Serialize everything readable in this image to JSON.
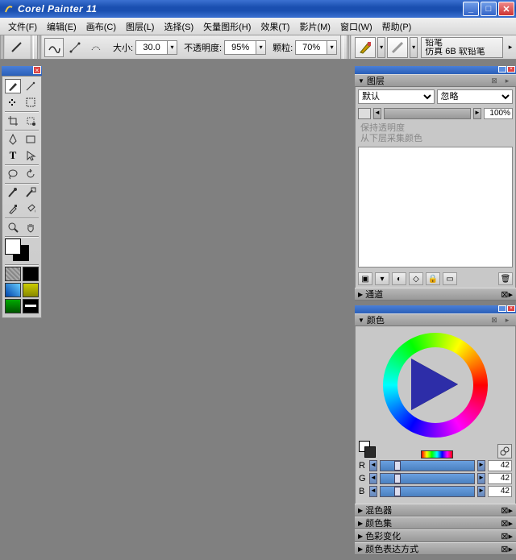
{
  "app_title": "Corel Painter 11",
  "menu": [
    "文件(F)",
    "编辑(E)",
    "画布(C)",
    "图层(L)",
    "选择(S)",
    "矢量图形(H)",
    "效果(T)",
    "影片(M)",
    "窗口(W)",
    "帮助(P)"
  ],
  "options": {
    "size_label": "大小:",
    "size_value": "30.0",
    "opacity_label": "不透明度:",
    "opacity_value": "95%",
    "grain_label": "颗粒:",
    "grain_value": "70%"
  },
  "brush": {
    "category": "铅笔",
    "variant": "仿真 6B 软铅笔"
  },
  "panels": {
    "layers": {
      "title": "图层",
      "blend_mode": "默认",
      "composite": "忽略",
      "opacity": "100%",
      "lock_trans": "保持透明度",
      "pick_color": "从下层采集颜色",
      "channels_title": "通道"
    },
    "color": {
      "title": "颜色",
      "r_label": "R",
      "r_value": "42",
      "g_label": "G",
      "g_value": "42",
      "b_label": "B",
      "b_value": "42",
      "subs": [
        "混色器",
        "颜色集",
        "色彩变化",
        "颜色表达方式"
      ]
    }
  },
  "icons": {
    "brush": "brush",
    "wand": "wand",
    "crop": "crop",
    "pen": "pen",
    "text": "text",
    "zoom": "zoom",
    "hand": "hand",
    "eyedrop": "eyedrop"
  },
  "chart_data": null
}
